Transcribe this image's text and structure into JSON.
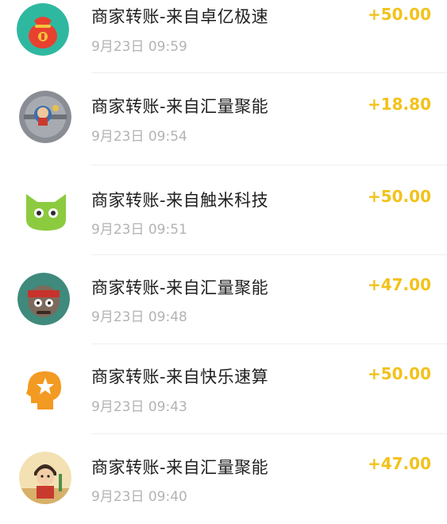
{
  "transactions": [
    {
      "avatar_icon": "red-lucky-bag-icon",
      "title": "商家转账-来自卓亿极速",
      "time": "9月23日  09:59",
      "amount": "+50.00"
    },
    {
      "avatar_icon": "game-character-on-gray-icon",
      "title": "商家转账-来自汇量聚能",
      "time": "9月23日  09:54",
      "amount": "+18.80"
    },
    {
      "avatar_icon": "green-cat-face-icon",
      "title": "商家转账-来自触米科技",
      "time": "9月23日  09:51",
      "amount": "+50.00"
    },
    {
      "avatar_icon": "ninja-character-icon",
      "title": "商家转账-来自汇量聚能",
      "time": "9月23日  09:48",
      "amount": "+47.00"
    },
    {
      "avatar_icon": "orange-head-with-star-icon",
      "title": "商家转账-来自快乐速算",
      "time": "9月23日  09:43",
      "amount": "+50.00"
    },
    {
      "avatar_icon": "cartoon-boy-character-icon",
      "title": "商家转账-来自汇量聚能",
      "time": "9月23日  09:40",
      "amount": "+47.00"
    }
  ],
  "colors": {
    "amount": "#f2c21b",
    "title": "#1f1f1f",
    "time": "#b3b3b3",
    "divider": "#eeeeee"
  }
}
